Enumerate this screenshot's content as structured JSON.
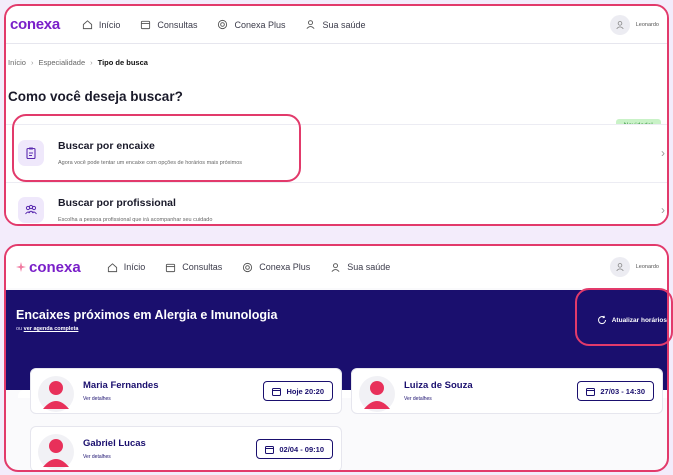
{
  "top": {
    "logo": "conexa",
    "nav": [
      {
        "label": "Início",
        "icon": "home-icon"
      },
      {
        "label": "Consultas",
        "icon": "calendar-icon"
      },
      {
        "label": "Conexa Plus",
        "icon": "plus-badge-icon"
      },
      {
        "label": "Sua saúde",
        "icon": "person-icon"
      }
    ],
    "user_name": "Leonardo",
    "breadcrumb": [
      "Início",
      "Especialidade",
      "Tipo de busca"
    ],
    "page_title": "Como você deseja buscar?",
    "badge_new": "Novidade!",
    "options": [
      {
        "title": "Buscar por encaixe",
        "description": "Agora você pode tentar um encaixe com opções de horários mais próximos",
        "icon": "clipboard-icon"
      },
      {
        "title": "Buscar por profissional",
        "description": "Escolha a pessoa profissional que irá acompanhar seu cuidado",
        "icon": "people-icon"
      }
    ]
  },
  "bottom": {
    "logo": "conexa",
    "nav": [
      {
        "label": "Início",
        "icon": "home-icon"
      },
      {
        "label": "Consultas",
        "icon": "calendar-icon"
      },
      {
        "label": "Conexa Plus",
        "icon": "plus-badge-icon"
      },
      {
        "label": "Sua saúde",
        "icon": "person-icon"
      }
    ],
    "user_name": "Leonardo",
    "hero_title": "Encaixes próximos em Alergia e Imunologia",
    "hero_sub_prefix": "ou",
    "hero_sub_link": "ver agenda completa",
    "refresh_label": "Atualizar horários",
    "cards": [
      {
        "name": "Maria Fernandes",
        "link": "Ver detalhes",
        "slot": "Hoje 20:20"
      },
      {
        "name": "Luiza de Souza",
        "link": "Ver detalhes",
        "slot": "27/03 - 14:30"
      },
      {
        "name": "Gabriel Lucas",
        "link": "Ver detalhes",
        "slot": "02/04 - 09:10"
      }
    ]
  },
  "colors": {
    "brand": "#7a1fc9",
    "navy": "#1a0f6e",
    "highlight": "#e23a6b",
    "avatar": "#e8305a",
    "badge_bg": "#c9f2c7"
  }
}
